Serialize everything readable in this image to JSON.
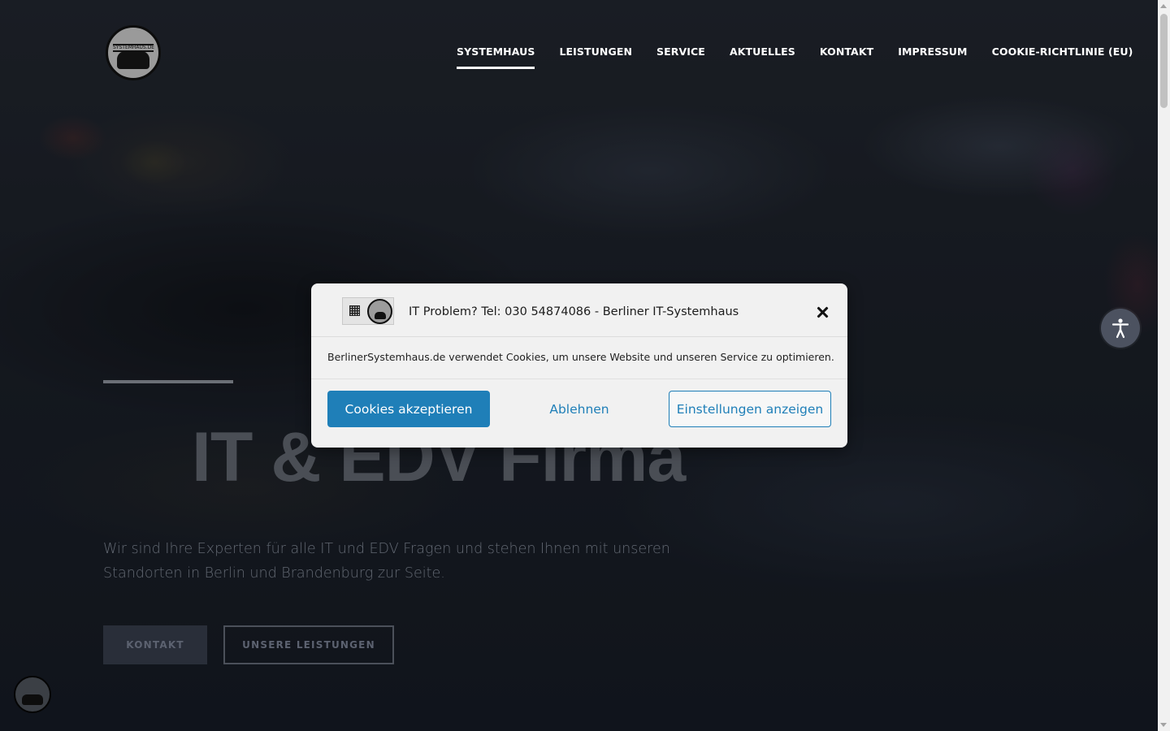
{
  "header": {
    "logo_text": "SYSTEMHAUS.DE",
    "nav": [
      {
        "label": "SYSTEMHAUS",
        "active": true
      },
      {
        "label": "LEISTUNGEN",
        "active": false
      },
      {
        "label": "SERVICE",
        "active": false
      },
      {
        "label": "AKTUELLES",
        "active": false
      },
      {
        "label": "KONTAKT",
        "active": false
      },
      {
        "label": "IMPRESSUM",
        "active": false
      },
      {
        "label": "COOKIE-RICHTLINIE (EU)",
        "active": false
      }
    ]
  },
  "hero": {
    "title": "IT & EDV Firma",
    "text": "Wir sind Ihre Experten für alle IT und EDV Fragen und stehen Ihnen mit unseren Standorten in Berlin und Brandenburg zur Seite.",
    "buttons": {
      "contact": "KONTAKT",
      "services": "UNSERE LEISTUNGEN"
    }
  },
  "cookie_modal": {
    "title": "IT Problem? Tel: 030 54874086 - Berliner IT-Systemhaus",
    "body": "BerlinerSystemhaus.de verwendet Cookies, um unsere Website und unseren Service zu optimieren.",
    "accept_label": "Cookies akzeptieren",
    "deny_label": "Ablehnen",
    "settings_label": "Einstellungen anzeigen"
  },
  "colors": {
    "accent": "#1f7fb8",
    "modal_bg": "#f1f1f1",
    "hero_bg": "#161a20"
  },
  "icons": {
    "close": "close-icon",
    "accessibility": "accessibility-icon"
  }
}
